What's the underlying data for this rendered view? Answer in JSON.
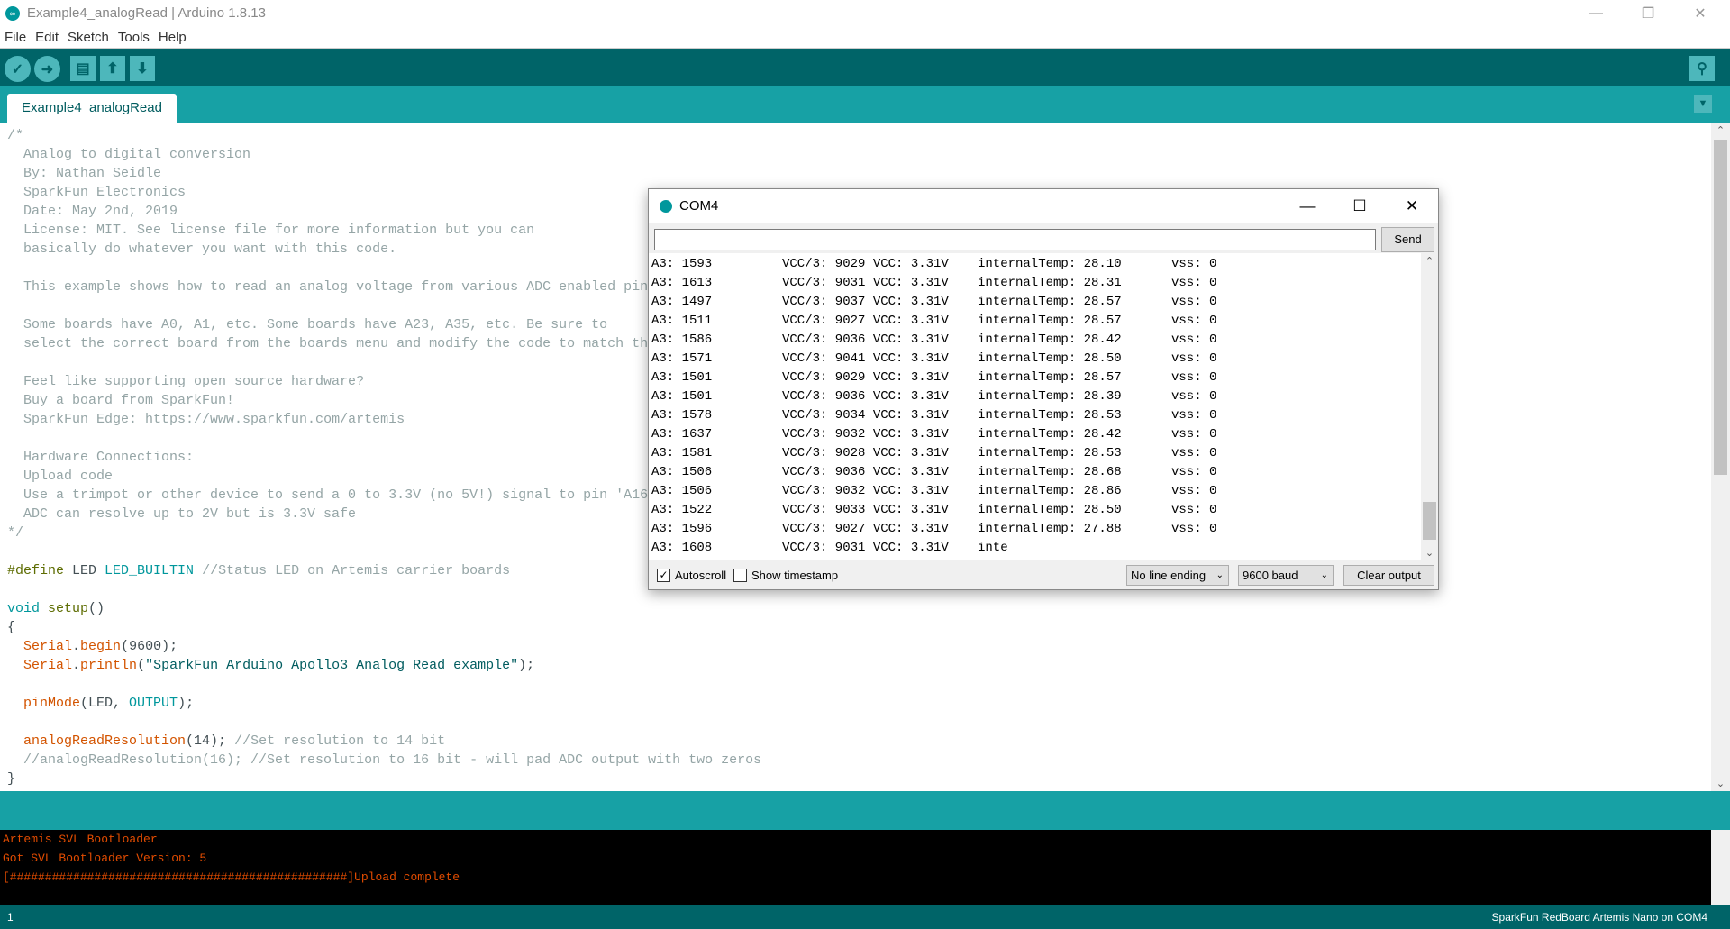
{
  "window": {
    "title": "Example4_analogRead | Arduino 1.8.13"
  },
  "menu": [
    "File",
    "Edit",
    "Sketch",
    "Tools",
    "Help"
  ],
  "toolbar": {
    "buttons": [
      "verify-icon",
      "upload-icon",
      "new-icon",
      "open-icon",
      "save-icon"
    ],
    "serial_monitor": "serial-monitor-icon"
  },
  "tab": {
    "label": "Example4_analogRead"
  },
  "colors": {
    "toolbar": "#006468",
    "tabbar": "#17A1A5",
    "console_text": "#E34C00",
    "keyword": "#00979C",
    "function": "#D35400",
    "comment": "#95a5a6"
  },
  "code": [
    [
      [
        "/*",
        "cm"
      ]
    ],
    [
      [
        "  Analog to digital conversion",
        "cm"
      ]
    ],
    [
      [
        "  By: Nathan Seidle",
        "cm"
      ]
    ],
    [
      [
        "  SparkFun Electronics",
        "cm"
      ]
    ],
    [
      [
        "  Date: May 2nd, 2019",
        "cm"
      ]
    ],
    [
      [
        "  License: MIT. See license file for more information but you can",
        "cm"
      ]
    ],
    [
      [
        "  basically do whatever you want with this code.",
        "cm"
      ]
    ],
    [],
    [
      [
        "  This example shows how to read an analog voltage from various ADC enabled pin",
        "cm"
      ]
    ],
    [],
    [
      [
        "  Some boards have A0, A1, etc. Some boards have A23, A35, etc. Be sure to",
        "cm"
      ]
    ],
    [
      [
        "  select the correct board from the boards menu and modify the code to match th",
        "cm"
      ]
    ],
    [],
    [
      [
        "  Feel like supporting open source hardware?",
        "cm"
      ]
    ],
    [
      [
        "  Buy a board from SparkFun!",
        "cm"
      ]
    ],
    [
      [
        "  SparkFun Edge: ",
        "cm"
      ],
      [
        "https://www.sparkfun.com/artemis",
        "lnk"
      ]
    ],
    [],
    [
      [
        "  Hardware Connections:",
        "cm"
      ]
    ],
    [
      [
        "  Upload code",
        "cm"
      ]
    ],
    [
      [
        "  Use a trimpot or other device to send a 0 to 3.3V (no 5V!) signal to pin 'A16",
        "cm"
      ]
    ],
    [
      [
        "  ADC can resolve up to 2V but is 3.3V safe",
        "cm"
      ]
    ],
    [
      [
        "*/",
        "cm"
      ]
    ],
    [],
    [
      [
        "#define",
        "pp"
      ],
      [
        " LED ",
        ""
      ],
      [
        "LED_BUILTIN",
        "kw"
      ],
      [
        " //Status LED on Artemis carrier boards",
        "cm"
      ]
    ],
    [],
    [
      [
        "void",
        "kw"
      ],
      [
        " ",
        ""
      ],
      [
        "setup",
        "pp"
      ],
      [
        "()",
        ""
      ]
    ],
    [
      [
        "{",
        ""
      ]
    ],
    [
      [
        "  ",
        ""
      ],
      [
        "Serial",
        "fn"
      ],
      [
        ".",
        ""
      ],
      [
        "begin",
        "fn"
      ],
      [
        "(9600);",
        ""
      ]
    ],
    [
      [
        "  ",
        ""
      ],
      [
        "Serial",
        "fn"
      ],
      [
        ".",
        ""
      ],
      [
        "println",
        "fn"
      ],
      [
        "(",
        ""
      ],
      [
        "\"SparkFun Arduino Apollo3 Analog Read example\"",
        "str"
      ],
      [
        ");",
        ""
      ]
    ],
    [],
    [
      [
        "  ",
        ""
      ],
      [
        "pinMode",
        "fn"
      ],
      [
        "(LED, ",
        ""
      ],
      [
        "OUTPUT",
        "kw"
      ],
      [
        ");",
        ""
      ]
    ],
    [],
    [
      [
        "  ",
        ""
      ],
      [
        "analogReadResolution",
        "fn"
      ],
      [
        "(14); ",
        ""
      ],
      [
        "//Set resolution to 14 bit",
        "cm"
      ]
    ],
    [
      [
        "  //analogReadResolution(16); //Set resolution to 16 bit - will pad ADC output with two zeros",
        "cm"
      ]
    ],
    [
      [
        "}",
        ""
      ]
    ]
  ],
  "console": [
    "Artemis SVL Bootloader",
    "Got SVL Bootloader Version: 5",
    "[################################################]Upload complete"
  ],
  "status": {
    "line": "1",
    "board": "SparkFun RedBoard Artemis Nano on COM4"
  },
  "serial_monitor": {
    "title": "COM4",
    "input_value": "",
    "send_label": "Send",
    "lines": [
      [
        "A3: 1593",
        "VCC/3: 9029 VCC: 3.31V",
        "internalTemp: 28.10",
        "vss: 0"
      ],
      [
        "A3: 1613",
        "VCC/3: 9031 VCC: 3.31V",
        "internalTemp: 28.31",
        "vss: 0"
      ],
      [
        "A3: 1497",
        "VCC/3: 9037 VCC: 3.31V",
        "internalTemp: 28.57",
        "vss: 0"
      ],
      [
        "A3: 1511",
        "VCC/3: 9027 VCC: 3.31V",
        "internalTemp: 28.57",
        "vss: 0"
      ],
      [
        "A3: 1586",
        "VCC/3: 9036 VCC: 3.31V",
        "internalTemp: 28.42",
        "vss: 0"
      ],
      [
        "A3: 1571",
        "VCC/3: 9041 VCC: 3.31V",
        "internalTemp: 28.50",
        "vss: 0"
      ],
      [
        "A3: 1501",
        "VCC/3: 9029 VCC: 3.31V",
        "internalTemp: 28.57",
        "vss: 0"
      ],
      [
        "A3: 1501",
        "VCC/3: 9036 VCC: 3.31V",
        "internalTemp: 28.39",
        "vss: 0"
      ],
      [
        "A3: 1578",
        "VCC/3: 9034 VCC: 3.31V",
        "internalTemp: 28.53",
        "vss: 0"
      ],
      [
        "A3: 1637",
        "VCC/3: 9032 VCC: 3.31V",
        "internalTemp: 28.42",
        "vss: 0"
      ],
      [
        "A3: 1581",
        "VCC/3: 9028 VCC: 3.31V",
        "internalTemp: 28.53",
        "vss: 0"
      ],
      [
        "A3: 1506",
        "VCC/3: 9036 VCC: 3.31V",
        "internalTemp: 28.68",
        "vss: 0"
      ],
      [
        "A3: 1506",
        "VCC/3: 9032 VCC: 3.31V",
        "internalTemp: 28.86",
        "vss: 0"
      ],
      [
        "A3: 1522",
        "VCC/3: 9033 VCC: 3.31V",
        "internalTemp: 28.50",
        "vss: 0"
      ],
      [
        "A3: 1596",
        "VCC/3: 9027 VCC: 3.31V",
        "internalTemp: 27.88",
        "vss: 0"
      ],
      [
        "A3: 1608",
        "VCC/3: 9031 VCC: 3.31V",
        "inte",
        ""
      ]
    ],
    "autoscroll": {
      "label": "Autoscroll",
      "checked": true
    },
    "timestamp": {
      "label": "Show timestamp",
      "checked": false
    },
    "line_ending": "No line ending",
    "baud": "9600 baud",
    "clear_label": "Clear output"
  }
}
